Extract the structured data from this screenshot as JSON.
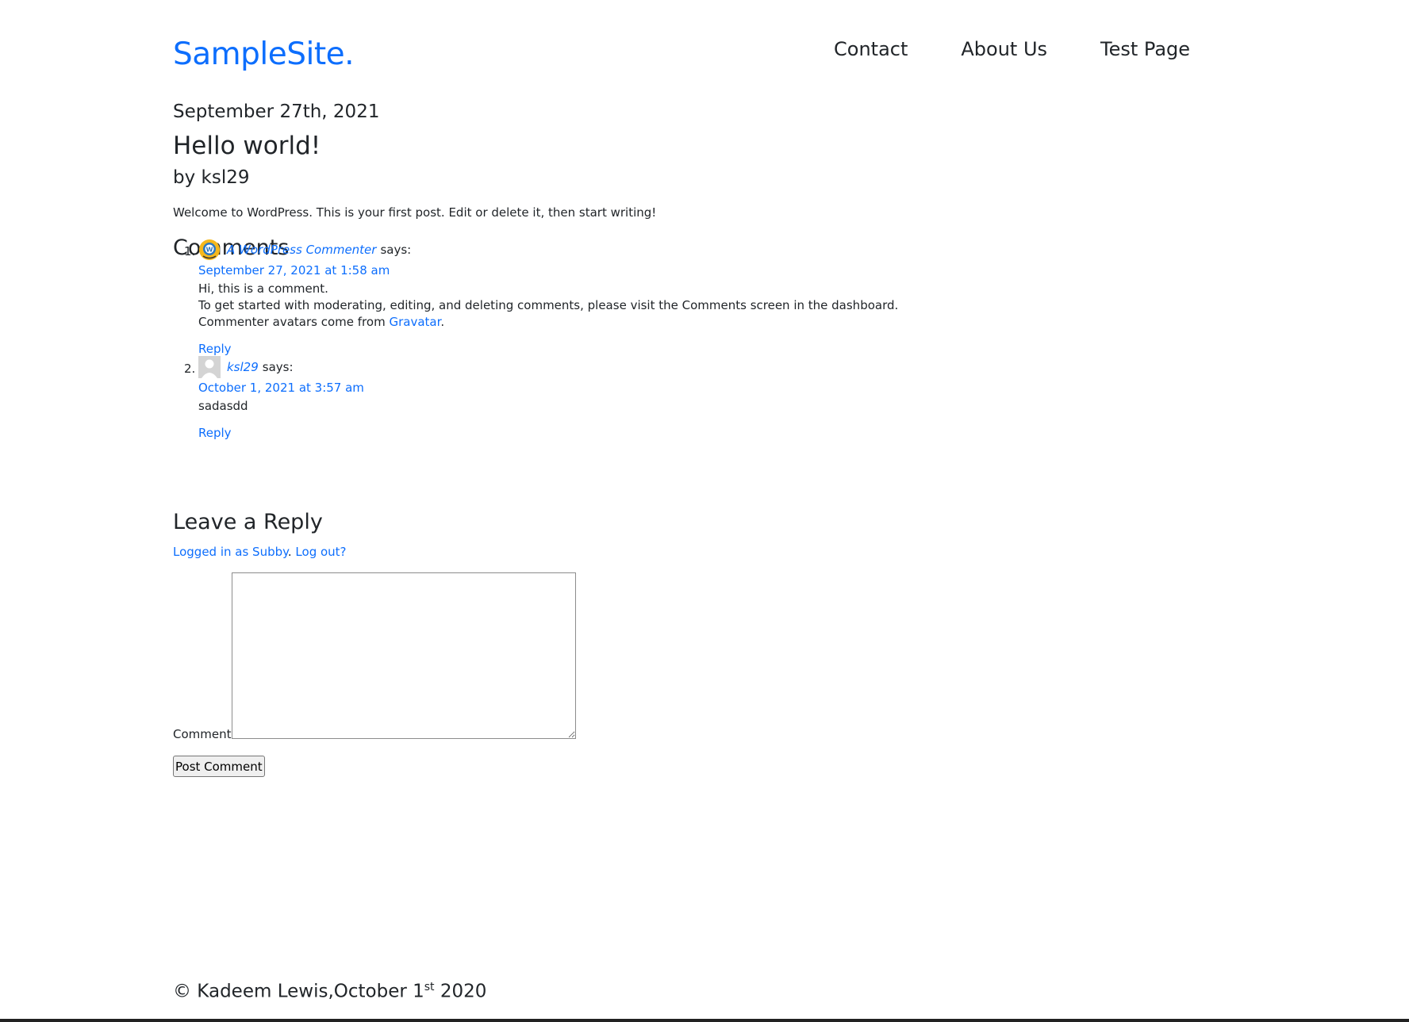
{
  "header": {
    "logo": "SampleSite.",
    "nav": [
      "Contact",
      "About Us",
      "Test Page"
    ]
  },
  "post": {
    "date": "September 27th, 2021",
    "title": "Hello world!",
    "author": "by ksl29",
    "body": "Welcome to WordPress. This is your first post. Edit or delete it, then start writing!"
  },
  "comments": {
    "heading": "Comments",
    "items": [
      {
        "number": "1.",
        "author": "A WordPress Commenter",
        "says": "says:",
        "date": "September 27, 2021 at 1:58 am",
        "lines": [
          "Hi, this is a comment.",
          "To get started with moderating, editing, and deleting comments, please visit the Comments screen in the dashboard."
        ],
        "avatar_line_prefix": "Commenter avatars come from",
        "avatar_link": "Gravatar",
        "avatar_line_suffix": ".",
        "reply": "Reply"
      },
      {
        "number": "2.",
        "author": "ksl29",
        "says": "says:",
        "date": "October 1, 2021 at 3:57 am",
        "lines": [
          "sadasdd"
        ],
        "reply": "Reply"
      }
    ]
  },
  "reply_form": {
    "heading": "Leave a Reply",
    "logged_in_link": "Logged in as Subby",
    "separator": ".",
    "logout_link": "Log out?",
    "comment_label": "Comment",
    "submit_label": "Post Comment"
  },
  "footer": {
    "text_before": "© Kadeem Lewis,October 1",
    "superscript": "st",
    "text_after": " 2020"
  },
  "colors": {
    "link": "#0d6efd",
    "text": "#212529",
    "background": "#ffffff"
  }
}
